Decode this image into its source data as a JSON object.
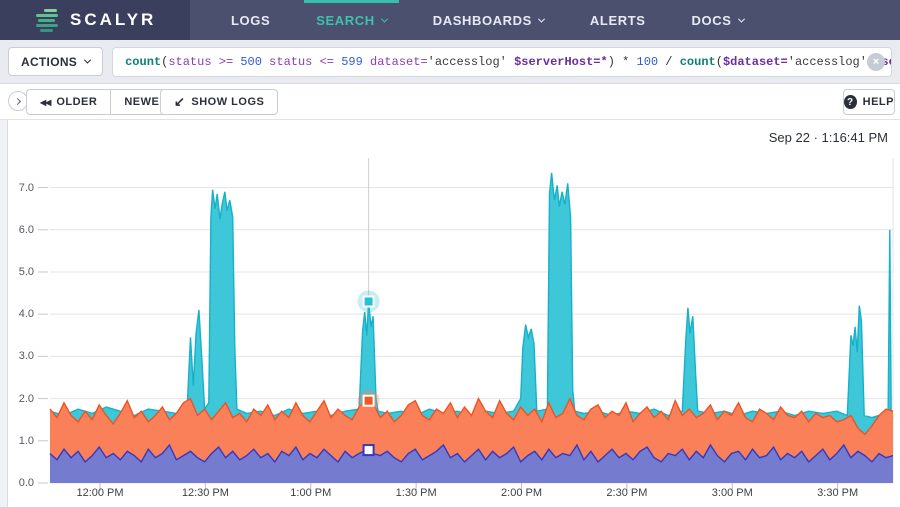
{
  "accent_colors": {
    "teal": "#35c0ad",
    "nav_bg": "#4b506f",
    "brand_bg": "#3b3f5e"
  },
  "nav": {
    "brand": "SCALYR",
    "logo_bar_colors": [
      "#86cfa0",
      "#5cc391",
      "#47b089",
      "#3fa184",
      "#37947e"
    ],
    "items": [
      {
        "label": "LOGS",
        "caret": false,
        "active": false
      },
      {
        "label": "SEARCH",
        "caret": true,
        "active": true
      },
      {
        "label": "DASHBOARDS",
        "caret": true,
        "active": false
      },
      {
        "label": "ALERTS",
        "caret": false,
        "active": false
      },
      {
        "label": "DOCS",
        "caret": true,
        "active": false
      }
    ]
  },
  "search_bar": {
    "actions_label": "ACTIONS",
    "remove_icon": "×",
    "clear_icon": "×",
    "query_tokens": [
      {
        "text": "count",
        "cls": "fn"
      },
      {
        "text": "(",
        "cls": "pl"
      },
      {
        "text": "status",
        "cls": "attr"
      },
      {
        "text": " >= ",
        "cls": "op"
      },
      {
        "text": "500",
        "cls": "num"
      },
      {
        "text": " ",
        "cls": "pl"
      },
      {
        "text": "status",
        "cls": "attr"
      },
      {
        "text": " <= ",
        "cls": "op"
      },
      {
        "text": "599",
        "cls": "num"
      },
      {
        "text": " ",
        "cls": "pl"
      },
      {
        "text": "dataset",
        "cls": "attr"
      },
      {
        "text": "=",
        "cls": "op"
      },
      {
        "text": "'accesslog'",
        "cls": "str"
      },
      {
        "text": " ",
        "cls": "pl"
      },
      {
        "text": "$serverHost",
        "cls": "var"
      },
      {
        "text": "=*",
        "cls": "var"
      },
      {
        "text": ")",
        "cls": "pl"
      },
      {
        "text": " * ",
        "cls": "pl"
      },
      {
        "text": "100",
        "cls": "num"
      },
      {
        "text": " / ",
        "cls": "pl"
      },
      {
        "text": "count",
        "cls": "fn"
      },
      {
        "text": "(",
        "cls": "pl"
      },
      {
        "text": "$dataset",
        "cls": "var"
      },
      {
        "text": "=",
        "cls": "var"
      },
      {
        "text": "'accesslog'",
        "cls": "str"
      },
      {
        "text": " ",
        "cls": "pl"
      },
      {
        "text": "$serverHost",
        "cls": "var"
      },
      {
        "text": "=*",
        "cls": "var"
      },
      {
        "text": ")",
        "cls": "pl"
      }
    ]
  },
  "toolbar": {
    "older_label": "OLDER",
    "newer_label": "NEWER",
    "show_logs_label": "SHOW LOGS",
    "help_label": "HELP",
    "older_icon": "◀◀",
    "newer_icon": "▶▶",
    "show_logs_icon": "↙",
    "help_icon": "?"
  },
  "chart_header": {
    "timestamp": "Sep 22 · 1:16:41 PM"
  },
  "chart_data": {
    "type": "area",
    "title": "",
    "grid": true,
    "legend": "none",
    "x_axis": {
      "total_minutes": 240,
      "tick_first_minute": 14.24,
      "tick_interval_minutes": 30,
      "tick_labels": [
        "12:00 PM",
        "12:30 PM",
        "1:00 PM",
        "1:30 PM",
        "2:00 PM",
        "2:30 PM",
        "3:00 PM",
        "3:30 PM"
      ]
    },
    "y_axis": {
      "min": 0,
      "max": 7.7,
      "tick_labels": [
        "0.0",
        "1.0",
        "2.0",
        "3.0",
        "4.0",
        "5.0",
        "6.0",
        "7.0"
      ]
    },
    "series": [
      {
        "name": "series-cyan",
        "fill": "#3ec6d9",
        "stroke": "#17b1c9",
        "points": [
          [
            0,
            1.7
          ],
          [
            4,
            1.6
          ],
          [
            8,
            1.75
          ],
          [
            12,
            1.65
          ],
          [
            16,
            1.8
          ],
          [
            20,
            1.7
          ],
          [
            24,
            1.6
          ],
          [
            28,
            1.75
          ],
          [
            32,
            1.7
          ],
          [
            36,
            1.65
          ],
          [
            39,
            1.7
          ],
          [
            40,
            3.45
          ],
          [
            40.8,
            2.3
          ],
          [
            41.6,
            3.55
          ],
          [
            42.4,
            4.1
          ],
          [
            43.2,
            3.0
          ],
          [
            44,
            1.75
          ],
          [
            45.2,
            1.9
          ],
          [
            45.8,
            6.3
          ],
          [
            46.3,
            6.95
          ],
          [
            47,
            6.5
          ],
          [
            47.6,
            6.85
          ],
          [
            48.4,
            6.25
          ],
          [
            49,
            6.6
          ],
          [
            49.8,
            6.9
          ],
          [
            50.4,
            6.45
          ],
          [
            51.2,
            6.7
          ],
          [
            52,
            6.3
          ],
          [
            52.6,
            3.2
          ],
          [
            53.2,
            1.75
          ],
          [
            56,
            1.65
          ],
          [
            60,
            1.7
          ],
          [
            64,
            1.6
          ],
          [
            68,
            1.75
          ],
          [
            72,
            1.65
          ],
          [
            76,
            1.7
          ],
          [
            80,
            1.6
          ],
          [
            84,
            1.7
          ],
          [
            88,
            1.75
          ],
          [
            89,
            3.6
          ],
          [
            89.6,
            4.05
          ],
          [
            90.2,
            3.5
          ],
          [
            90.7,
            4.3
          ],
          [
            91.4,
            3.7
          ],
          [
            92,
            3.95
          ],
          [
            92.8,
            2.0
          ],
          [
            93.4,
            1.7
          ],
          [
            96,
            1.65
          ],
          [
            100,
            1.7
          ],
          [
            104,
            1.6
          ],
          [
            108,
            1.75
          ],
          [
            112,
            1.65
          ],
          [
            116,
            1.7
          ],
          [
            120,
            1.6
          ],
          [
            124,
            1.7
          ],
          [
            128,
            1.65
          ],
          [
            132,
            1.7
          ],
          [
            134,
            2.0
          ],
          [
            134.6,
            3.2
          ],
          [
            135.4,
            3.75
          ],
          [
            136.2,
            3.45
          ],
          [
            137,
            3.65
          ],
          [
            137.8,
            3.3
          ],
          [
            138.6,
            1.7
          ],
          [
            141.6,
            1.75
          ],
          [
            142.2,
            6.85
          ],
          [
            142.8,
            7.35
          ],
          [
            143.6,
            6.7
          ],
          [
            144.4,
            7.05
          ],
          [
            145,
            6.55
          ],
          [
            145.8,
            6.9
          ],
          [
            146.6,
            6.6
          ],
          [
            147.4,
            7.1
          ],
          [
            148.2,
            6.3
          ],
          [
            148.8,
            2.2
          ],
          [
            149.4,
            1.7
          ],
          [
            152,
            1.65
          ],
          [
            156,
            1.7
          ],
          [
            160,
            1.6
          ],
          [
            164,
            1.7
          ],
          [
            168,
            1.65
          ],
          [
            172,
            1.75
          ],
          [
            176,
            1.6
          ],
          [
            180,
            1.7
          ],
          [
            181,
            3.4
          ],
          [
            181.6,
            4.15
          ],
          [
            182.2,
            3.55
          ],
          [
            183,
            3.95
          ],
          [
            183.8,
            2.6
          ],
          [
            184.4,
            1.7
          ],
          [
            188,
            1.65
          ],
          [
            192,
            1.7
          ],
          [
            196,
            1.6
          ],
          [
            200,
            1.7
          ],
          [
            204,
            1.65
          ],
          [
            208,
            1.7
          ],
          [
            212,
            1.6
          ],
          [
            216,
            1.7
          ],
          [
            220,
            1.65
          ],
          [
            224,
            1.7
          ],
          [
            227,
            1.6
          ],
          [
            228,
            3.5
          ],
          [
            228.6,
            3.25
          ],
          [
            229.2,
            3.7
          ],
          [
            229.8,
            3.1
          ],
          [
            230.4,
            4.2
          ],
          [
            231,
            3.85
          ],
          [
            231.8,
            1.6
          ],
          [
            234,
            1.55
          ],
          [
            236,
            1.6
          ],
          [
            238.6,
            1.6
          ],
          [
            239.1,
            6.0
          ],
          [
            239.5,
            1.6
          ],
          [
            240,
            1.55
          ]
        ]
      },
      {
        "name": "series-orange",
        "fill": "#f98059",
        "stroke": "#ee5322",
        "step": 2,
        "values": [
          1.75,
          1.55,
          1.9,
          1.6,
          1.45,
          1.7,
          1.5,
          1.85,
          1.6,
          1.4,
          1.65,
          1.95,
          1.55,
          1.7,
          1.45,
          1.6,
          1.8,
          1.5,
          1.65,
          1.9,
          2.0,
          1.6,
          1.75,
          1.5,
          1.7,
          1.9,
          1.55,
          1.65,
          1.45,
          1.75,
          1.6,
          1.85,
          1.5,
          1.7,
          1.55,
          1.9,
          1.6,
          1.45,
          1.7,
          1.95,
          1.55,
          1.75,
          1.6,
          1.5,
          1.8,
          1.95,
          1.9,
          1.55,
          1.7,
          1.45,
          1.6,
          1.85,
          1.95,
          1.6,
          1.5,
          1.75,
          1.65,
          1.9,
          1.55,
          1.8,
          1.6,
          2.0,
          1.7,
          1.55,
          1.95,
          1.65,
          1.5,
          1.8,
          1.6,
          1.75,
          1.45,
          1.9,
          1.55,
          1.65,
          2.0,
          1.6,
          1.5,
          1.75,
          1.85,
          1.55,
          1.7,
          1.6,
          1.9,
          1.45,
          1.65,
          1.8,
          1.55,
          1.7,
          1.5,
          1.95,
          1.6,
          1.75,
          1.55,
          1.65,
          1.85,
          1.5,
          1.7,
          1.6,
          1.9,
          1.55,
          1.45,
          1.75,
          1.65,
          1.5,
          1.8,
          1.6,
          1.55,
          1.7,
          1.45,
          1.65,
          1.55,
          1.6,
          1.45,
          1.5,
          1.6,
          1.3,
          1.15,
          1.35,
          1.6,
          1.75,
          1.7
        ]
      },
      {
        "name": "series-blue",
        "fill": "#757bce",
        "stroke": "#3439c0",
        "step": 2,
        "values": [
          0.7,
          0.55,
          0.8,
          0.6,
          0.75,
          0.5,
          0.65,
          0.85,
          0.6,
          0.7,
          0.55,
          0.75,
          0.65,
          0.5,
          0.8,
          0.6,
          0.7,
          0.9,
          0.55,
          0.65,
          0.75,
          0.6,
          0.5,
          0.7,
          0.85,
          0.6,
          0.75,
          0.55,
          0.65,
          0.8,
          0.6,
          0.7,
          0.5,
          0.75,
          0.65,
          0.85,
          0.55,
          0.7,
          0.6,
          0.8,
          0.65,
          0.5,
          0.75,
          0.6,
          0.7,
          0.78,
          0.7,
          0.65,
          0.75,
          0.6,
          0.5,
          0.7,
          0.8,
          0.55,
          0.65,
          0.75,
          0.9,
          0.6,
          0.7,
          0.5,
          0.65,
          0.8,
          0.55,
          0.75,
          0.6,
          0.7,
          0.85,
          0.5,
          0.65,
          0.75,
          0.55,
          0.8,
          0.6,
          0.7,
          0.65,
          0.9,
          0.55,
          0.75,
          0.5,
          0.65,
          0.8,
          0.6,
          0.7,
          0.55,
          0.75,
          0.85,
          0.6,
          0.5,
          0.7,
          0.65,
          0.8,
          0.55,
          0.75,
          0.6,
          0.9,
          0.65,
          0.5,
          0.7,
          0.75,
          0.55,
          0.8,
          0.6,
          0.65,
          0.85,
          0.55,
          0.7,
          0.6,
          0.75,
          0.5,
          0.65,
          0.8,
          0.55,
          0.7,
          0.9,
          0.6,
          0.75,
          0.65,
          0.5,
          0.7,
          0.6,
          0.65
        ]
      }
    ],
    "crosshair": {
      "minute": 90.7,
      "markers": [
        {
          "series": "series-cyan",
          "value": 4.3,
          "style": "filled"
        },
        {
          "series": "series-orange",
          "value": 1.95,
          "style": "filled"
        },
        {
          "series": "series-blue",
          "value": 0.78,
          "style": "hollow"
        }
      ]
    }
  }
}
